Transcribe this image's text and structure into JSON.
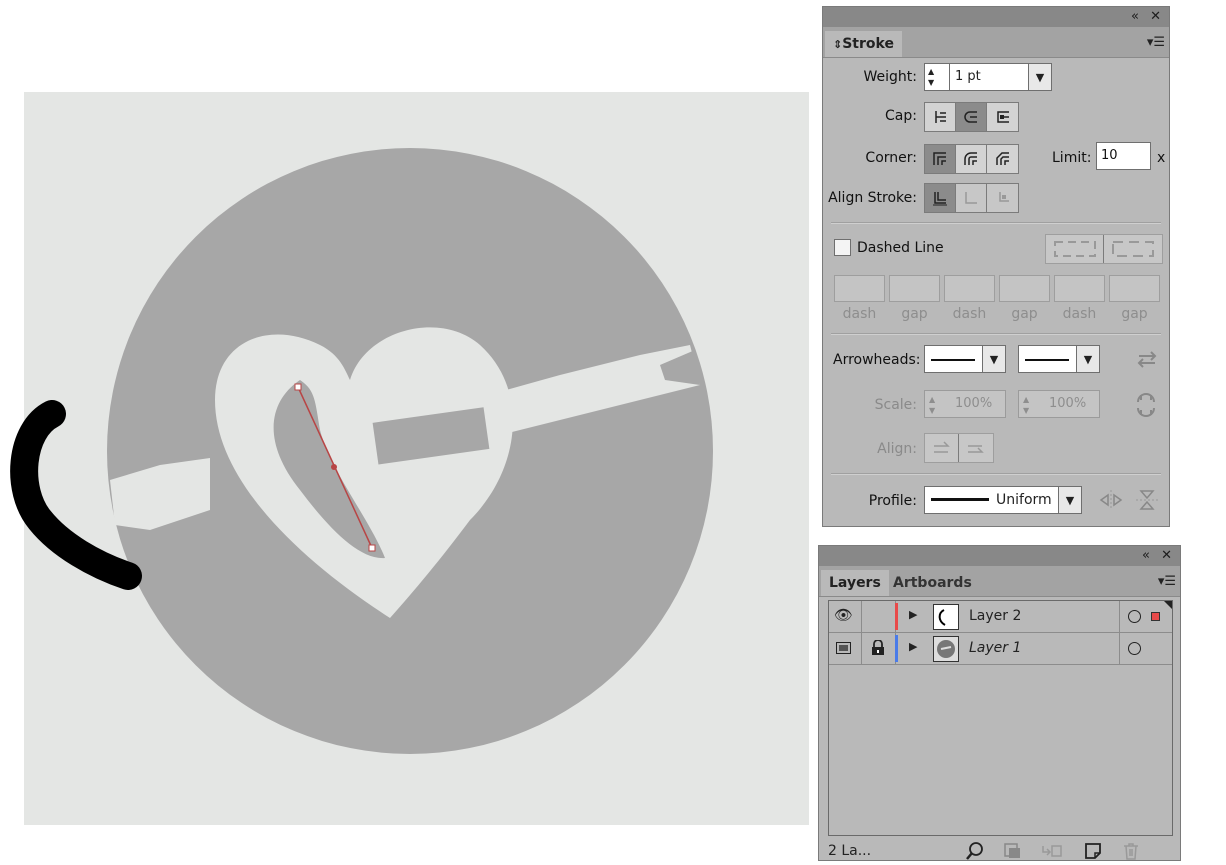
{
  "stroke_panel": {
    "tab_label": "Stroke",
    "weight_label": "Weight:",
    "weight_value": "1 pt",
    "cap_label": "Cap:",
    "corner_label": "Corner:",
    "limit_label": "Limit:",
    "limit_value": "10",
    "limit_unit": "x",
    "align_stroke_label": "Align Stroke:",
    "dashed_line_label": "Dashed Line",
    "dash_labels": [
      "dash",
      "gap",
      "dash",
      "gap",
      "dash",
      "gap"
    ],
    "arrowheads_label": "Arrowheads:",
    "scale_label": "Scale:",
    "scale_start": "100%",
    "scale_end": "100%",
    "align_label": "Align:",
    "profile_label": "Profile:",
    "profile_value": "Uniform"
  },
  "layers_panel": {
    "tabs": [
      "Layers",
      "Artboards"
    ],
    "layers": [
      {
        "name": "Layer 2",
        "visible": true,
        "locked": false,
        "color": "#e84a4a",
        "targeted": true
      },
      {
        "name": "Layer 1",
        "visible": true,
        "locked": true,
        "color": "#4a7be8",
        "targeted": false
      }
    ],
    "footer_text": "2 La..."
  },
  "icons": {
    "collapse": "double-chevron-left-icon",
    "close": "close-icon",
    "panel_menu": "panel-menu-icon",
    "swap": "swap-arrowheads-icon",
    "link": "link-scale-icon",
    "search": "locate-object-icon",
    "clipping": "make-clipping-mask-icon",
    "new_sublayer": "new-sublayer-icon",
    "new_layer": "new-layer-icon",
    "delete": "trash-icon"
  }
}
